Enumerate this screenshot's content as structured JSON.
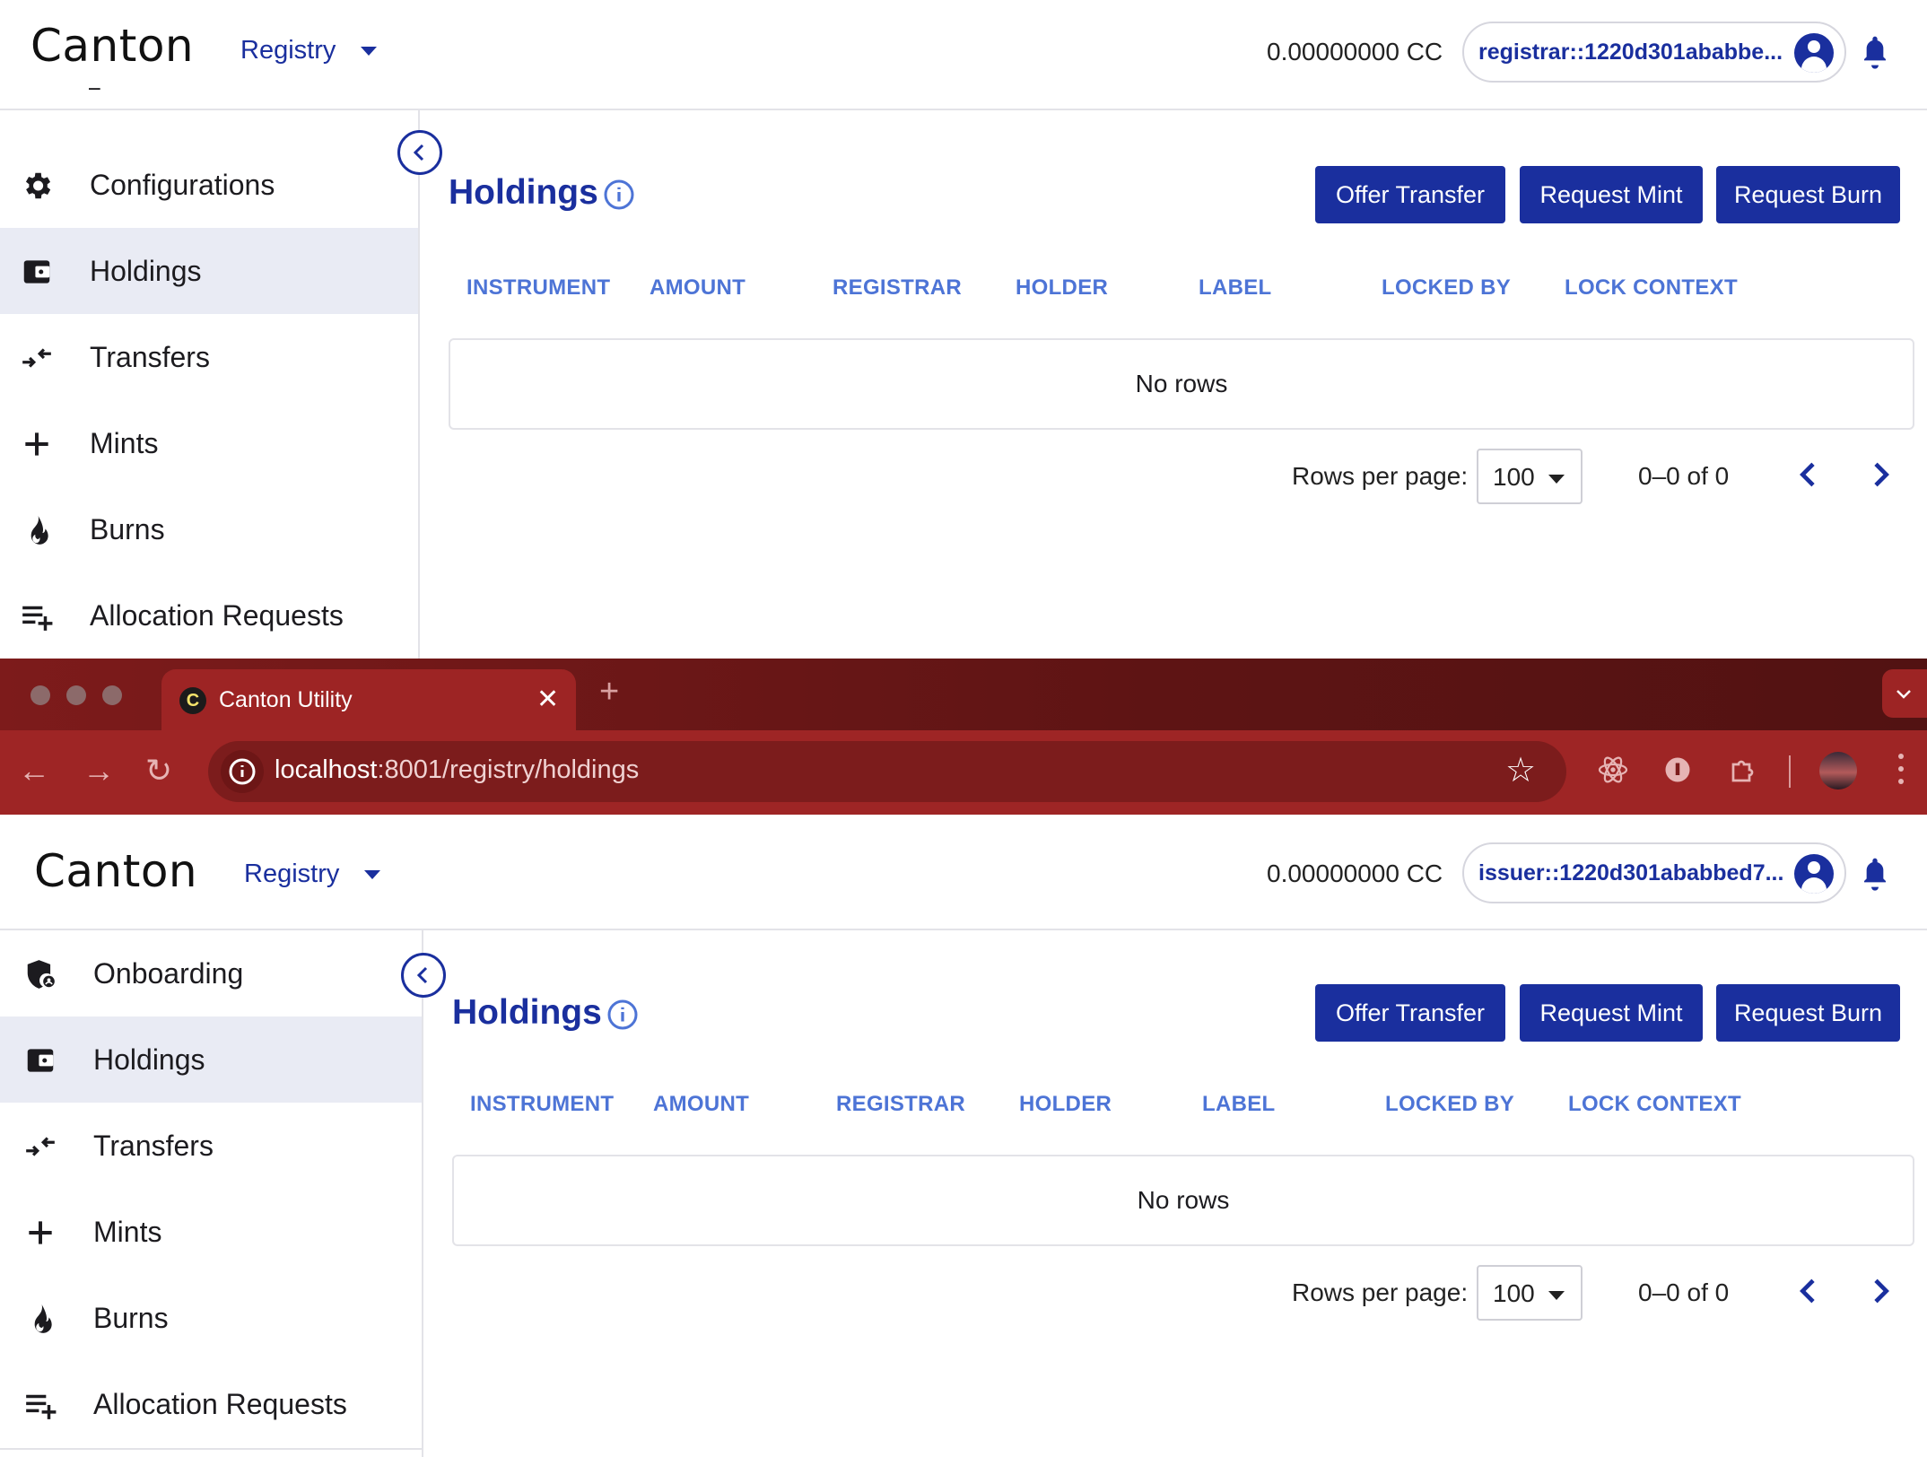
{
  "top_window": {
    "header": {
      "logo": "Canton",
      "context": "Registry",
      "balance": "0.00000000 CC",
      "party": "registrar::1220d301ababbe..."
    },
    "sidebar": {
      "items": [
        {
          "label": "Configurations",
          "icon": "gear-icon",
          "active": false
        },
        {
          "label": "Holdings",
          "icon": "wallet-icon",
          "active": true
        },
        {
          "label": "Transfers",
          "icon": "transfer-arrows-icon",
          "active": false
        },
        {
          "label": "Mints",
          "icon": "plus-icon",
          "active": false
        },
        {
          "label": "Burns",
          "icon": "flame-icon",
          "active": false
        },
        {
          "label": "Allocation Requests",
          "icon": "playlist-add-icon",
          "active": false
        }
      ]
    },
    "main": {
      "title": "Holdings",
      "buttons": {
        "offer": "Offer Transfer",
        "mint": "Request Mint",
        "burn": "Request Burn"
      },
      "columns": [
        "INSTRUMENT",
        "AMOUNT",
        "REGISTRAR",
        "HOLDER",
        "LABEL",
        "LOCKED BY",
        "LOCK CONTEXT"
      ],
      "empty": "No rows",
      "rows_per_page_label": "Rows per page:",
      "rows_per_page": "100",
      "page_range": "0–0 of 0"
    }
  },
  "browser": {
    "tab_title": "Canton Utility",
    "favicon_letter": "C",
    "url_host": "localhost",
    "url_rest": ":8001/registry/holdings"
  },
  "bottom_window": {
    "header": {
      "logo": "Canton",
      "context": "Registry",
      "balance": "0.00000000 CC",
      "party": "issuer::1220d301ababbed7..."
    },
    "sidebar": {
      "items": [
        {
          "label": "Onboarding",
          "icon": "shield-icon",
          "active": false
        },
        {
          "label": "Holdings",
          "icon": "wallet-icon",
          "active": true
        },
        {
          "label": "Transfers",
          "icon": "transfer-arrows-icon",
          "active": false
        },
        {
          "label": "Mints",
          "icon": "plus-icon",
          "active": false
        },
        {
          "label": "Burns",
          "icon": "flame-icon",
          "active": false
        },
        {
          "label": "Allocation Requests",
          "icon": "playlist-add-icon",
          "active": false
        }
      ]
    },
    "main": {
      "title": "Holdings",
      "buttons": {
        "offer": "Offer Transfer",
        "mint": "Request Mint",
        "burn": "Request Burn"
      },
      "columns": [
        "INSTRUMENT",
        "AMOUNT",
        "REGISTRAR",
        "HOLDER",
        "LABEL",
        "LOCKED BY",
        "LOCK CONTEXT"
      ],
      "empty": "No rows",
      "rows_per_page_label": "Rows per page:",
      "rows_per_page": "100",
      "page_range": "0–0 of 0"
    }
  },
  "colors": {
    "primary": "#1a2f9e",
    "column_header": "#4d74d6",
    "active_row": "#e9ebf4",
    "browser_frame": "#9e2525"
  }
}
